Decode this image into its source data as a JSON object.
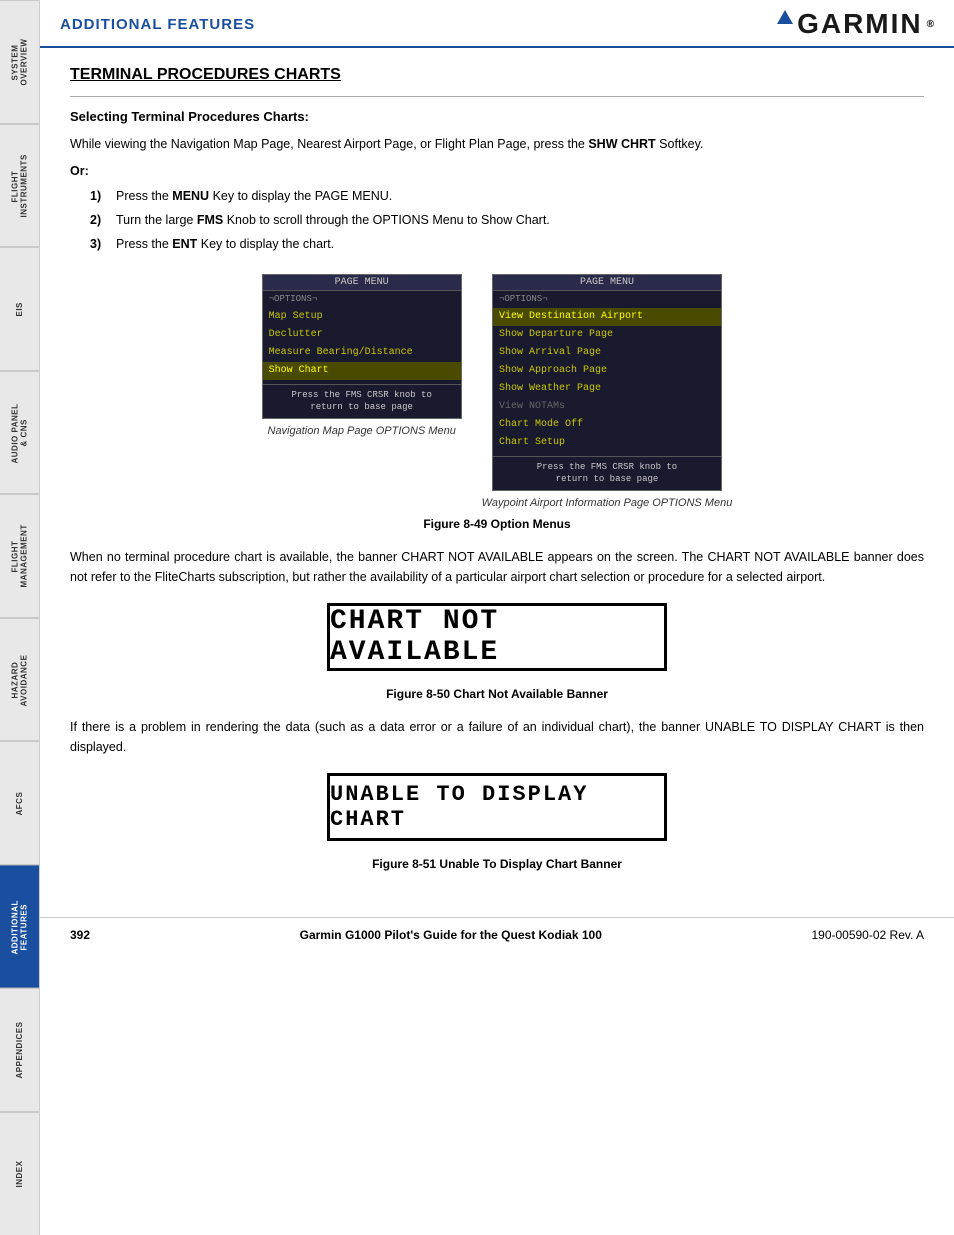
{
  "header": {
    "title": "ADDITIONAL FEATURES",
    "logo_text": "GARMIN"
  },
  "sidebar": {
    "tabs": [
      {
        "id": "system-overview",
        "label": "SYSTEM\nOVERVIEW",
        "active": false
      },
      {
        "id": "flight-instruments",
        "label": "FLIGHT\nINSTRUMENTS",
        "active": false
      },
      {
        "id": "eis",
        "label": "EIS",
        "active": false
      },
      {
        "id": "audio-panel",
        "label": "AUDIO PANEL\n& CNS",
        "active": false
      },
      {
        "id": "flight-management",
        "label": "FLIGHT\nMANAGEMENT",
        "active": false
      },
      {
        "id": "hazard-avoidance",
        "label": "HAZARD\nAVOIDANCE",
        "active": false
      },
      {
        "id": "afcs",
        "label": "AFCS",
        "active": false
      },
      {
        "id": "additional-features",
        "label": "ADDITIONAL\nFEATURES",
        "active": true
      },
      {
        "id": "appendices",
        "label": "APPENDICES",
        "active": false
      },
      {
        "id": "index",
        "label": "INDEX",
        "active": false
      }
    ]
  },
  "section": {
    "title": "TERMINAL PROCEDURES CHARTS",
    "subsection_title": "Selecting Terminal Procedures Charts:",
    "intro_text": "While viewing the Navigation Map Page, Nearest Airport Page, or Flight Plan Page, press the SHW CHRT Softkey.",
    "shw_chrt_bold": "SHW CHRT",
    "or_label": "Or:",
    "steps": [
      {
        "num": "1)",
        "text": "Press the MENU Key to display the PAGE MENU.",
        "bold": "MENU"
      },
      {
        "num": "2)",
        "text": "Turn the large FMS Knob to scroll through the OPTIONS Menu to Show Chart.",
        "bold": "FMS"
      },
      {
        "num": "3)",
        "text": "Press the ENT Key to display the chart.",
        "bold": "ENT"
      }
    ]
  },
  "menu_left": {
    "title": "PAGE MENU",
    "header_item": "OPTIONS",
    "items": [
      "Map Setup",
      "Declutter",
      "Measure Bearing/Distance",
      "Show Chart"
    ],
    "selected_item": "Show Chart",
    "footer": "Press the FMS CRSR knob to\nreturn to base page"
  },
  "menu_right": {
    "title": "PAGE MENU",
    "header_item": "OPTIONS",
    "items": [
      "View Destination Airport",
      "Show Departure Page",
      "Show Arrival Page",
      "Show Approach Page",
      "Show Weather Page",
      "View NOTAMs",
      "Chart Mode Off",
      "Chart Setup"
    ],
    "selected_item": "View Destination Airport",
    "dimmed_item": "View NOTAMs",
    "footer": "Press the FMS CRSR knob to\nreturn to base page"
  },
  "caption_left": "Navigation Map Page OPTIONS Menu",
  "caption_right": "Waypoint Airport Information Page OPTIONS Menu",
  "figure_49_caption": "Figure 8-49  Option Menus",
  "paragraph_1": "When no terminal procedure chart is available, the banner CHART NOT AVAILABLE appears on the screen. The CHART NOT AVAILABLE banner does not refer to the FliteCharts subscription, but rather the availability of a particular airport chart selection or procedure for a selected airport.",
  "chart_not_available_text": "CHART NOT AVAILABLE",
  "figure_50_caption": "Figure 8-50  Chart Not Available Banner",
  "paragraph_2": "If there is a problem in rendering the data (such as a data error or a failure of an individual chart), the banner UNABLE TO DISPLAY CHART is then displayed.",
  "unable_to_display_text": "UNABLE TO DISPLAY CHART",
  "figure_51_caption": "Figure 8-51  Unable To Display Chart Banner",
  "footer": {
    "page_num": "392",
    "title": "Garmin G1000 Pilot's Guide for the Quest Kodiak 100",
    "revision": "190-00590-02  Rev. A"
  }
}
